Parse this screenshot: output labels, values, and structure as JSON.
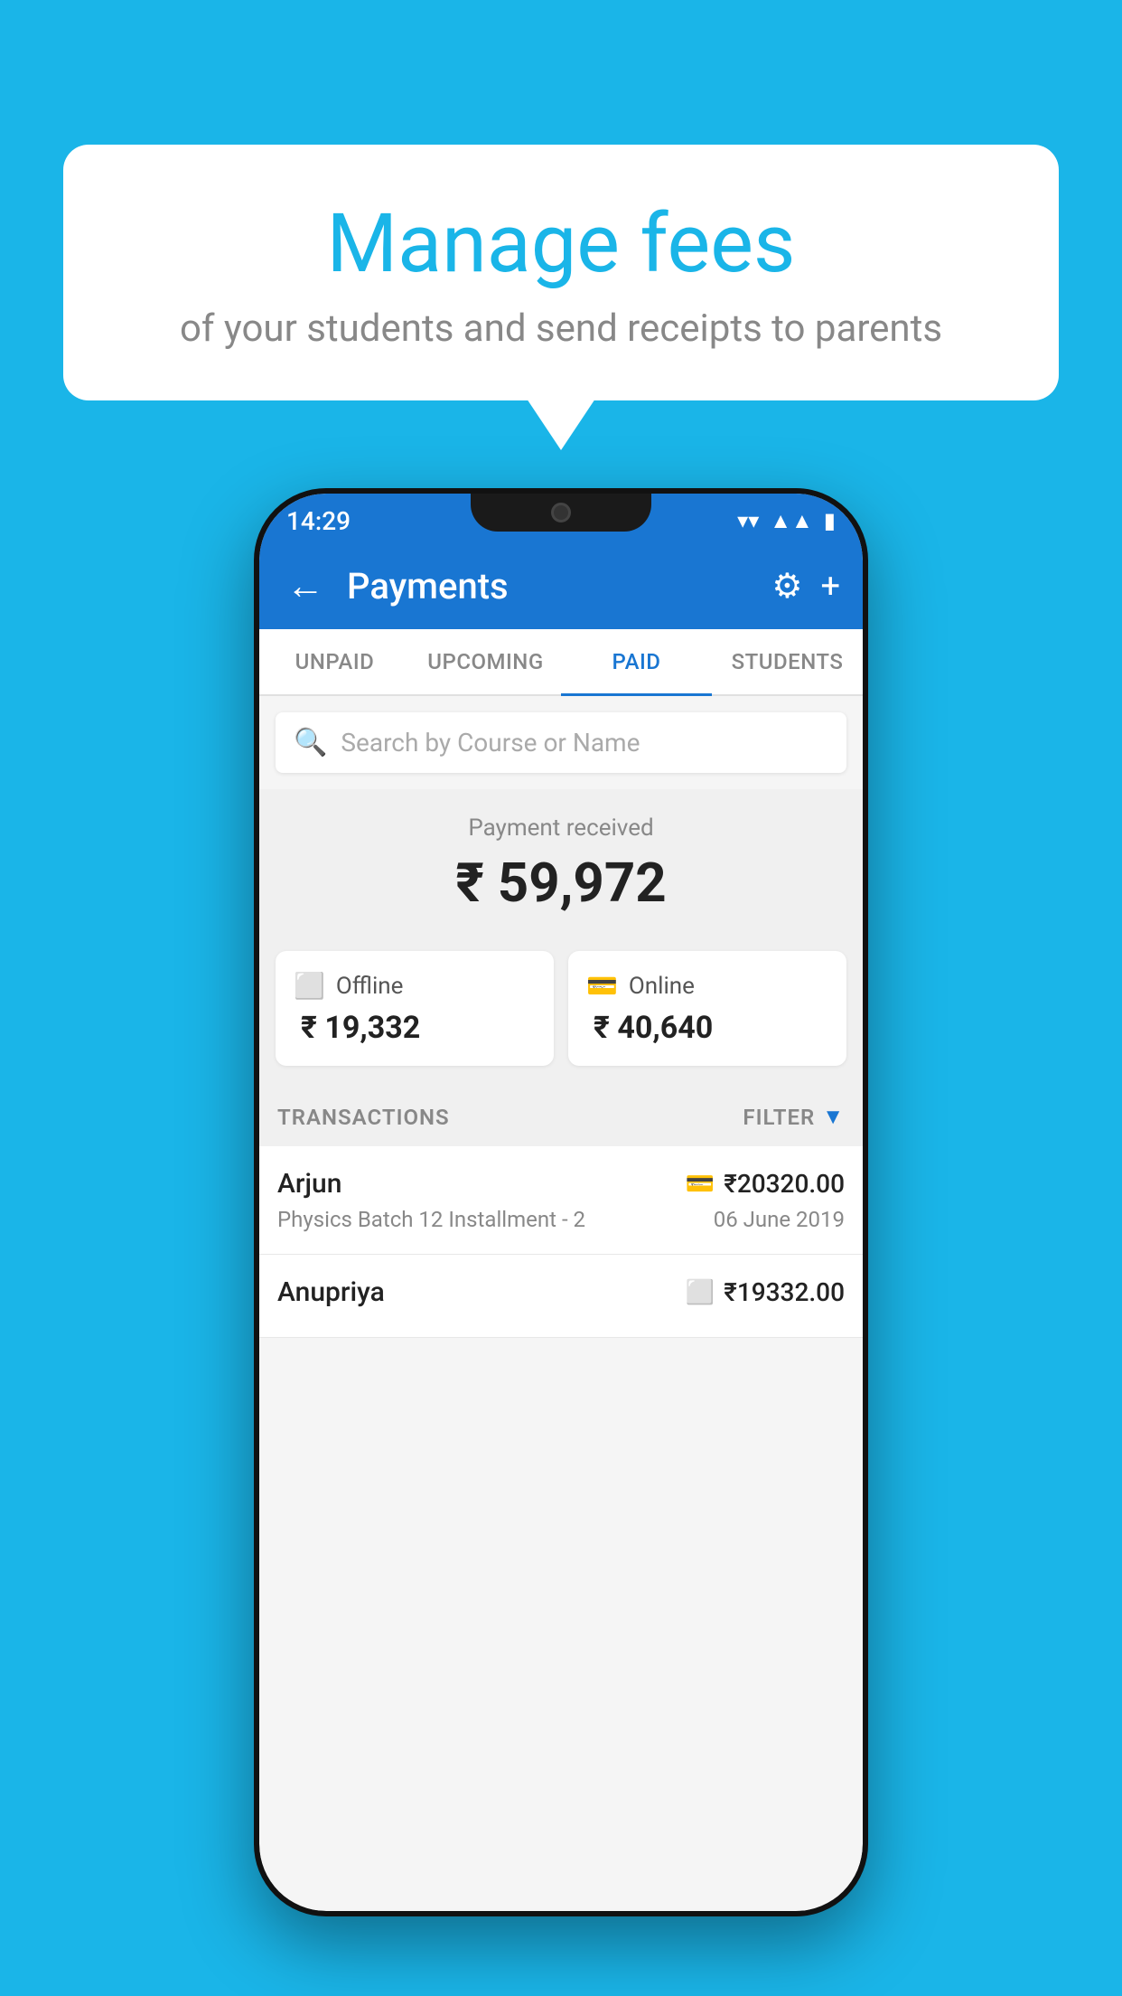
{
  "background_color": "#1ab5e8",
  "speech_bubble": {
    "title": "Manage fees",
    "subtitle": "of your students and send receipts to parents"
  },
  "phone": {
    "status_bar": {
      "time": "14:29"
    },
    "app_bar": {
      "title": "Payments",
      "back_label": "←",
      "settings_label": "⚙",
      "add_label": "+"
    },
    "tabs": [
      {
        "label": "UNPAID",
        "active": false
      },
      {
        "label": "UPCOMING",
        "active": false
      },
      {
        "label": "PAID",
        "active": true
      },
      {
        "label": "STUDENTS",
        "active": false
      }
    ],
    "search": {
      "placeholder": "Search by Course or Name"
    },
    "payment_summary": {
      "label": "Payment received",
      "amount": "₹ 59,972"
    },
    "payment_cards": [
      {
        "icon": "💳",
        "label": "Offline",
        "amount": "₹ 19,332"
      },
      {
        "icon": "🃏",
        "label": "Online",
        "amount": "₹ 40,640"
      }
    ],
    "transactions": {
      "header_label": "TRANSACTIONS",
      "filter_label": "FILTER"
    },
    "transaction_rows": [
      {
        "name": "Arjun",
        "amount": "₹20320.00",
        "payment_icon": "🃏",
        "course": "Physics Batch 12 Installment - 2",
        "date": "06 June 2019"
      },
      {
        "name": "Anupriya",
        "amount": "₹19332.00",
        "payment_icon": "💳",
        "course": "",
        "date": ""
      }
    ]
  }
}
